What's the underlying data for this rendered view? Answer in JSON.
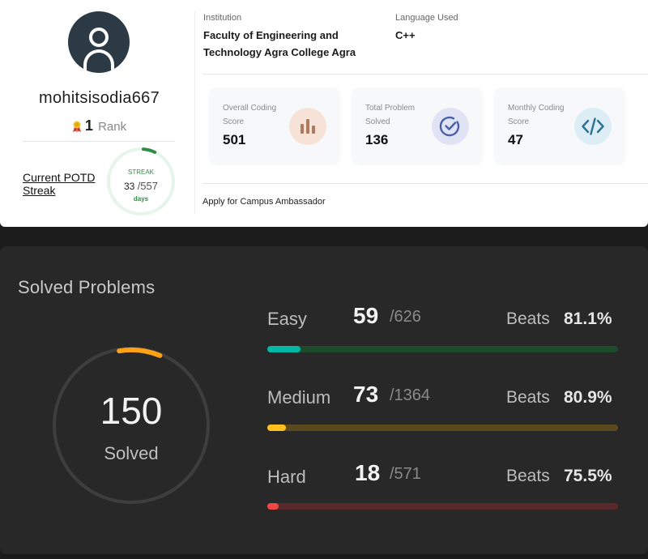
{
  "profile": {
    "username": "mohitsisodia667",
    "rank_value": "1",
    "rank_label": "Rank",
    "potd_label": "Current POTD Streak",
    "streak": {
      "label": "STREAK",
      "current": "33",
      "total": "/557",
      "unit": "days",
      "progress": 0.059
    },
    "institution_label": "Institution",
    "institution_value": "Faculty of Engineering and Technology Agra College Agra",
    "language_label": "Language Used",
    "language_value": "C++",
    "scores": [
      {
        "label": "Overall Coding Score",
        "value": "501",
        "icon": "bar-chart-icon"
      },
      {
        "label": "Total Problem Solved",
        "value": "136",
        "icon": "check-circle-icon"
      },
      {
        "label": "Monthly Coding Score",
        "value": "47",
        "icon": "code-icon"
      }
    ],
    "ambassador_link": "Apply for Campus Ambassador"
  },
  "leetcode": {
    "title": "Solved Problems",
    "total_solved": "150",
    "solved_label": "Solved",
    "difficulties": [
      {
        "name": "Easy",
        "solved": "59",
        "total": "/626",
        "beats_label": "Beats",
        "beats": "81.1%",
        "progress": 0.094,
        "color": "#00b8a3",
        "track": "#1f4b2d"
      },
      {
        "name": "Medium",
        "solved": "73",
        "total": "/1364",
        "beats_label": "Beats",
        "beats": "80.9%",
        "progress": 0.054,
        "color": "#ffc01e",
        "track": "#5b4a1d"
      },
      {
        "name": "Hard",
        "solved": "18",
        "total": "/571",
        "beats_label": "Beats",
        "beats": "75.5%",
        "progress": 0.032,
        "color": "#ef4743",
        "track": "#5a2a2a"
      }
    ],
    "colors": {
      "ring_track": "#3e3e3e",
      "ring_arc": "#ffa116"
    }
  }
}
